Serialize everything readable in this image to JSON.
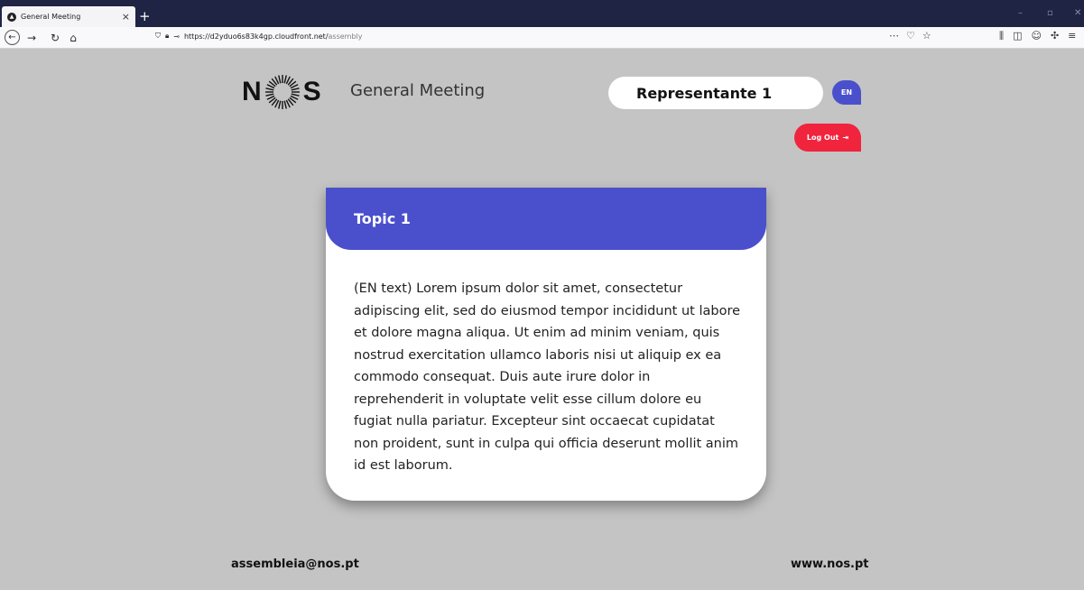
{
  "browser": {
    "tab_title": "General Meeting",
    "tab_close": "×",
    "new_tab": "+",
    "url_host": "https://d2yduo6s83k4gp.cloudfront.net/",
    "url_path": "assembly",
    "win_minimize": "–",
    "win_restore": "▫",
    "win_close": "✕"
  },
  "header": {
    "logo_left": "N",
    "logo_right": "S",
    "title": "General Meeting",
    "representative": "Representante 1",
    "language": "EN",
    "logout_label": "Log Out"
  },
  "topic": {
    "title": "Topic 1",
    "body": "(EN text) Lorem ipsum dolor sit amet, consectetur adipiscing elit, sed do eiusmod tempor incididunt ut labore et dolore magna aliqua. Ut enim ad minim veniam, quis nostrud exercitation ullamco laboris nisi ut aliquip ex ea commodo consequat. Duis aute irure dolor in reprehenderit in voluptate velit esse cillum dolore eu fugiat nulla pariatur. Excepteur sint occaecat cupidatat non proident, sunt in culpa qui officia deserunt mollit anim id est laborum."
  },
  "footer": {
    "email": "assembleia@nos.pt",
    "website": "www.nos.pt"
  },
  "colors": {
    "accent": "#4a50cc",
    "logout": "#f0243d",
    "background": "#c4c4c4"
  }
}
